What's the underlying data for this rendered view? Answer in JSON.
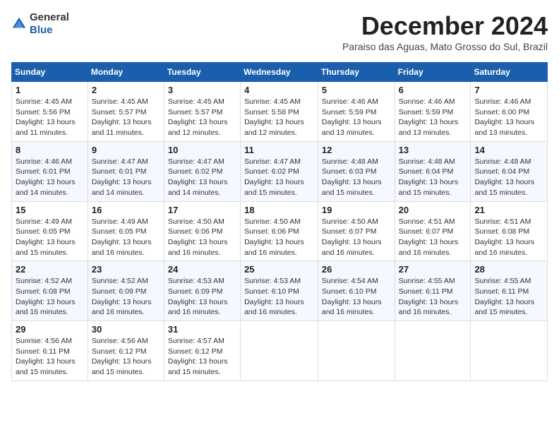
{
  "header": {
    "logo_general": "General",
    "logo_blue": "Blue",
    "month_title": "December 2024",
    "location": "Paraiso das Aguas, Mato Grosso do Sul, Brazil"
  },
  "weekdays": [
    "Sunday",
    "Monday",
    "Tuesday",
    "Wednesday",
    "Thursday",
    "Friday",
    "Saturday"
  ],
  "weeks": [
    [
      {
        "day": "1",
        "info": "Sunrise: 4:45 AM\nSunset: 5:56 PM\nDaylight: 13 hours and 11 minutes."
      },
      {
        "day": "2",
        "info": "Sunrise: 4:45 AM\nSunset: 5:57 PM\nDaylight: 13 hours and 11 minutes."
      },
      {
        "day": "3",
        "info": "Sunrise: 4:45 AM\nSunset: 5:57 PM\nDaylight: 13 hours and 12 minutes."
      },
      {
        "day": "4",
        "info": "Sunrise: 4:45 AM\nSunset: 5:58 PM\nDaylight: 13 hours and 12 minutes."
      },
      {
        "day": "5",
        "info": "Sunrise: 4:46 AM\nSunset: 5:59 PM\nDaylight: 13 hours and 13 minutes."
      },
      {
        "day": "6",
        "info": "Sunrise: 4:46 AM\nSunset: 5:59 PM\nDaylight: 13 hours and 13 minutes."
      },
      {
        "day": "7",
        "info": "Sunrise: 4:46 AM\nSunset: 6:00 PM\nDaylight: 13 hours and 13 minutes."
      }
    ],
    [
      {
        "day": "8",
        "info": "Sunrise: 4:46 AM\nSunset: 6:01 PM\nDaylight: 13 hours and 14 minutes."
      },
      {
        "day": "9",
        "info": "Sunrise: 4:47 AM\nSunset: 6:01 PM\nDaylight: 13 hours and 14 minutes."
      },
      {
        "day": "10",
        "info": "Sunrise: 4:47 AM\nSunset: 6:02 PM\nDaylight: 13 hours and 14 minutes."
      },
      {
        "day": "11",
        "info": "Sunrise: 4:47 AM\nSunset: 6:02 PM\nDaylight: 13 hours and 15 minutes."
      },
      {
        "day": "12",
        "info": "Sunrise: 4:48 AM\nSunset: 6:03 PM\nDaylight: 13 hours and 15 minutes."
      },
      {
        "day": "13",
        "info": "Sunrise: 4:48 AM\nSunset: 6:04 PM\nDaylight: 13 hours and 15 minutes."
      },
      {
        "day": "14",
        "info": "Sunrise: 4:48 AM\nSunset: 6:04 PM\nDaylight: 13 hours and 15 minutes."
      }
    ],
    [
      {
        "day": "15",
        "info": "Sunrise: 4:49 AM\nSunset: 6:05 PM\nDaylight: 13 hours and 15 minutes."
      },
      {
        "day": "16",
        "info": "Sunrise: 4:49 AM\nSunset: 6:05 PM\nDaylight: 13 hours and 16 minutes."
      },
      {
        "day": "17",
        "info": "Sunrise: 4:50 AM\nSunset: 6:06 PM\nDaylight: 13 hours and 16 minutes."
      },
      {
        "day": "18",
        "info": "Sunrise: 4:50 AM\nSunset: 6:06 PM\nDaylight: 13 hours and 16 minutes."
      },
      {
        "day": "19",
        "info": "Sunrise: 4:50 AM\nSunset: 6:07 PM\nDaylight: 13 hours and 16 minutes."
      },
      {
        "day": "20",
        "info": "Sunrise: 4:51 AM\nSunset: 6:07 PM\nDaylight: 13 hours and 16 minutes."
      },
      {
        "day": "21",
        "info": "Sunrise: 4:51 AM\nSunset: 6:08 PM\nDaylight: 13 hours and 16 minutes."
      }
    ],
    [
      {
        "day": "22",
        "info": "Sunrise: 4:52 AM\nSunset: 6:08 PM\nDaylight: 13 hours and 16 minutes."
      },
      {
        "day": "23",
        "info": "Sunrise: 4:52 AM\nSunset: 6:09 PM\nDaylight: 13 hours and 16 minutes."
      },
      {
        "day": "24",
        "info": "Sunrise: 4:53 AM\nSunset: 6:09 PM\nDaylight: 13 hours and 16 minutes."
      },
      {
        "day": "25",
        "info": "Sunrise: 4:53 AM\nSunset: 6:10 PM\nDaylight: 13 hours and 16 minutes."
      },
      {
        "day": "26",
        "info": "Sunrise: 4:54 AM\nSunset: 6:10 PM\nDaylight: 13 hours and 16 minutes."
      },
      {
        "day": "27",
        "info": "Sunrise: 4:55 AM\nSunset: 6:11 PM\nDaylight: 13 hours and 16 minutes."
      },
      {
        "day": "28",
        "info": "Sunrise: 4:55 AM\nSunset: 6:11 PM\nDaylight: 13 hours and 15 minutes."
      }
    ],
    [
      {
        "day": "29",
        "info": "Sunrise: 4:56 AM\nSunset: 6:11 PM\nDaylight: 13 hours and 15 minutes."
      },
      {
        "day": "30",
        "info": "Sunrise: 4:56 AM\nSunset: 6:12 PM\nDaylight: 13 hours and 15 minutes."
      },
      {
        "day": "31",
        "info": "Sunrise: 4:57 AM\nSunset: 6:12 PM\nDaylight: 13 hours and 15 minutes."
      },
      null,
      null,
      null,
      null
    ]
  ]
}
